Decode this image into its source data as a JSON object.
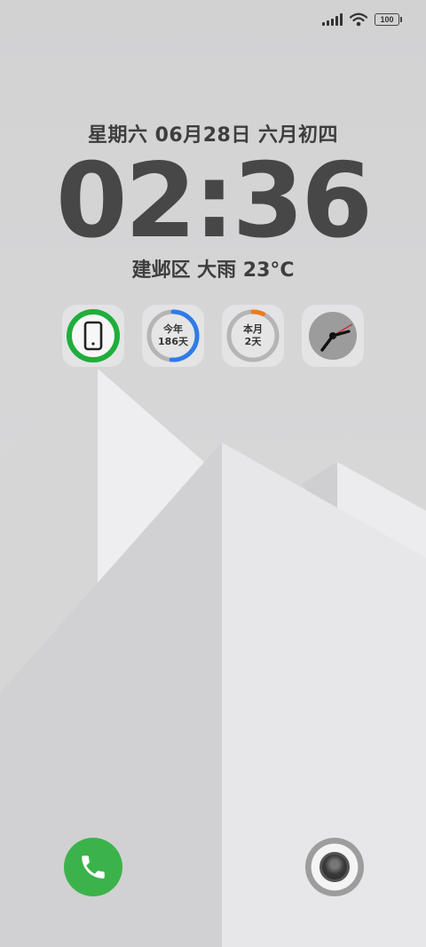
{
  "status_bar": {
    "battery_level": "100",
    "icons": [
      "signal-icon",
      "wifi-icon",
      "battery-icon"
    ]
  },
  "lock_screen": {
    "date": "星期六 06月28日 六月初四",
    "time": "02:36",
    "weather": "建邺区 大雨 23°C"
  },
  "widgets": [
    {
      "type": "phone-usage",
      "icon": "phone-icon",
      "ring_color": "#1fae3b",
      "progress": 1.0
    },
    {
      "type": "year-progress",
      "line1": "今年",
      "line2": "186天",
      "ring_color": "#2f7be8",
      "progress": 0.51
    },
    {
      "type": "month-progress",
      "line1": "本月",
      "line2": "2天",
      "ring_color": "#f07a18",
      "progress": 0.07
    },
    {
      "type": "analog-clock",
      "icon": "clock-icon"
    }
  ],
  "dock": {
    "left": "phone-icon",
    "right": "camera-icon"
  },
  "colors": {
    "phone_button": "#3cb34a",
    "text": "#3e3e3e"
  }
}
